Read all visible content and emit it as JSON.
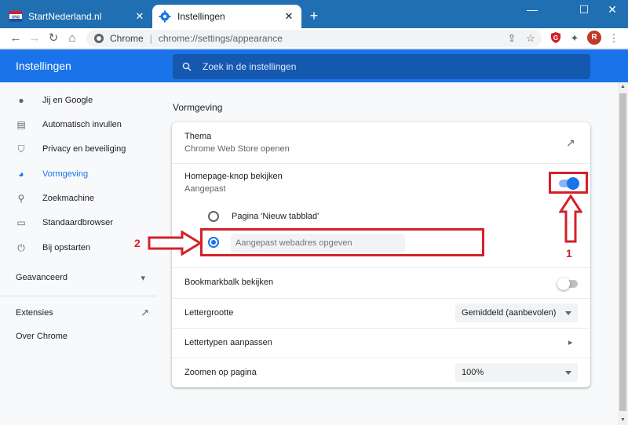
{
  "tabs": [
    {
      "title": "StartNederland.nl",
      "favicon": "startnederland-favicon",
      "close": "✕"
    },
    {
      "title": "Instellingen",
      "favicon": "gear-icon",
      "close": "✕"
    }
  ],
  "new_tab_label": "+",
  "window_controls": {
    "minimize": "—",
    "maximize": "☐",
    "close": "✕"
  },
  "address_bar": {
    "site_label": "Chrome",
    "separator": "|",
    "url": "chrome://settings/appearance"
  },
  "toolbar_icons": {
    "back": "←",
    "forward": "→",
    "reload": "↻",
    "home": "⌂",
    "share": "⇪",
    "star": "☆",
    "extensions": "✦",
    "avatar_letter": "R",
    "menu": "⋮"
  },
  "settings_header": {
    "title": "Instellingen",
    "search_placeholder": "Zoek in de instellingen"
  },
  "sidebar": {
    "items": [
      {
        "label": "Jij en Google",
        "icon": "person-icon",
        "glyph": "●"
      },
      {
        "label": "Automatisch invullen",
        "icon": "clipboard-icon",
        "glyph": "▤"
      },
      {
        "label": "Privacy en beveiliging",
        "icon": "shield-icon",
        "glyph": "⛉"
      },
      {
        "label": "Vormgeving",
        "icon": "palette-icon",
        "glyph": "◕"
      },
      {
        "label": "Zoekmachine",
        "icon": "search-icon",
        "glyph": "⚲"
      },
      {
        "label": "Standaardbrowser",
        "icon": "browser-icon",
        "glyph": "▭"
      },
      {
        "label": "Bij opstarten",
        "icon": "power-icon",
        "glyph": "⏻"
      }
    ],
    "advanced": {
      "label": "Geavanceerd",
      "caret": "▾"
    },
    "extensions": {
      "label": "Extensies",
      "icon_glyph": "↗"
    },
    "about": {
      "label": "Over Chrome"
    }
  },
  "main": {
    "section_title": "Vormgeving",
    "theme": {
      "label": "Thema",
      "sub": "Chrome Web Store openen",
      "icon_glyph": "↗"
    },
    "homepage": {
      "label": "Homepage-knop bekijken",
      "sub": "Aangepast",
      "enabled": true
    },
    "homepage_options": {
      "newtab_label": "Pagina 'Nieuw tabblad'",
      "custom_placeholder": "Aangepast webadres opgeven",
      "selected": "custom"
    },
    "bookmarks": {
      "label": "Bookmarkbalk bekijken",
      "enabled": false
    },
    "fontsize": {
      "label": "Lettergrootte",
      "value": "Gemiddeld (aanbevolen)"
    },
    "fonts": {
      "label": "Lettertypen aanpassen",
      "arrow": "▸"
    },
    "zoom": {
      "label": "Zoomen op pagina",
      "value": "100%"
    }
  },
  "annotations": {
    "arrow1_label": "1",
    "arrow2_label": "2"
  },
  "colors": {
    "accent": "#1a73e8",
    "titlebar": "#1f6fb2",
    "annotation_red": "#d4202a"
  }
}
